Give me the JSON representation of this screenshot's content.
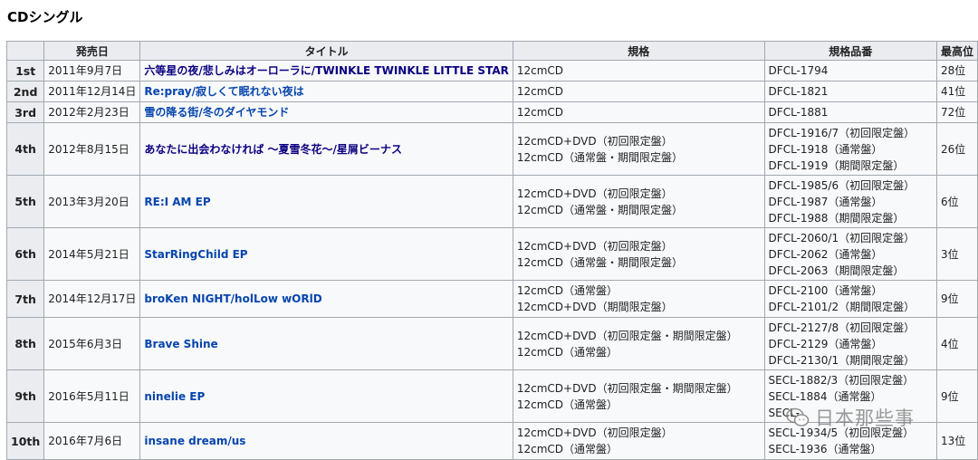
{
  "page": {
    "section_title": "CDシングル"
  },
  "table": {
    "headers": [
      "",
      "発売日",
      "タイトル",
      "規格",
      "規格品番",
      "最高位"
    ],
    "rows": [
      {
        "num": "1st",
        "date": "2011年9月7日",
        "title": "六等星の夜/悲しみはオーローラに/TWINKLE TWINKLE LITTLE STAR",
        "title_visited": true,
        "formats": [
          "12cmCD"
        ],
        "catalog": [
          "DFCL-1794"
        ],
        "peak": "28位"
      },
      {
        "num": "2nd",
        "date": "2011年12月14日",
        "title": "Re:pray/寂しくて眠れない夜は",
        "title_visited": false,
        "formats": [
          "12cmCD"
        ],
        "catalog": [
          "DFCL-1821"
        ],
        "peak": "41位"
      },
      {
        "num": "3rd",
        "date": "2012年2月23日",
        "title": "雪の降る街/冬のダイヤモンド",
        "title_visited": false,
        "formats": [
          "12cmCD"
        ],
        "catalog": [
          "DFCL-1881"
        ],
        "peak": "72位"
      },
      {
        "num": "4th",
        "date": "2012年8月15日",
        "title": "あなたに出会わなければ 〜夏雪冬花〜/星屑ビーナス",
        "title_visited": true,
        "formats": [
          "12cmCD+DVD（初回限定盤）",
          "12cmCD（通常盤・期間限定盤）"
        ],
        "catalog": [
          "DFCL-1916/7（初回限定盤）",
          "DFCL-1918（通常盤）",
          "DFCL-1919（期間限定盤）"
        ],
        "peak": "26位"
      },
      {
        "num": "5th",
        "date": "2013年3月20日",
        "title": "RE:I AM EP",
        "title_visited": false,
        "formats": [
          "12cmCD+DVD（初回限定盤）",
          "12cmCD（通常盤・期間限定盤）"
        ],
        "catalog": [
          "DFCL-1985/6（初回限定盤）",
          "DFCL-1987（通常盤）",
          "DFCL-1988（期間限定盤）"
        ],
        "peak": "6位"
      },
      {
        "num": "6th",
        "date": "2014年5月21日",
        "title": "StarRingChild EP",
        "title_visited": false,
        "formats": [
          "12cmCD+DVD（初回限定盤）",
          "12cmCD（通常盤・期間限定盤）"
        ],
        "catalog": [
          "DFCL-2060/1（初回限定盤）",
          "DFCL-2062（通常盤）",
          "DFCL-2063（期間限定盤）"
        ],
        "peak": "3位"
      },
      {
        "num": "7th",
        "date": "2014年12月17日",
        "title": "broKen NIGHT/holLow wORlD",
        "title_visited": false,
        "formats": [
          "12cmCD（通常盤）",
          "12cmCD+DVD（期間限定盤）"
        ],
        "catalog": [
          "DFCL-2100（通常盤）",
          "DFCL-2101/2（期間限定盤）"
        ],
        "peak": "9位"
      },
      {
        "num": "8th",
        "date": "2015年6月3日",
        "title": "Brave Shine",
        "title_visited": false,
        "formats": [
          "12cmCD+DVD（初回限定盤・期間限定盤）",
          "12cmCD（通常盤）"
        ],
        "catalog": [
          "DFCL-2127/8（初回限定盤）",
          "DFCL-2129（通常盤）",
          "DFCL-2130/1（期間限定盤）"
        ],
        "peak": "4位"
      },
      {
        "num": "9th",
        "date": "2016年5月11日",
        "title": "ninelie EP",
        "title_visited": false,
        "formats": [
          "12cmCD+DVD（初回限定盤・期間限定盤）",
          "12cmCD（通常盤）"
        ],
        "catalog": [
          "SECL-1882/3（初回限定盤）",
          "SECL-1884（通常盤）",
          "SECL-"
        ],
        "peak": "9位"
      },
      {
        "num": "10th",
        "date": "2016年7月6日",
        "title": "insane dream/us",
        "title_visited": false,
        "formats": [
          "12cmCD+DVD（初回限定盤）",
          "12cmCD（通常盤）"
        ],
        "catalog": [
          "SECL-1934/5（初回限定盤）",
          "SECL-1936（通常盤）"
        ],
        "peak": "13位"
      }
    ]
  },
  "watermark": {
    "text": "日本那些事",
    "icon": "wechat-icon"
  },
  "colors": {
    "link": "#0645ad",
    "link_visited": "#0b0080",
    "header_bg": "#eaecf0",
    "cell_bg": "#f8f9fa",
    "border": "#a2a9b1"
  }
}
